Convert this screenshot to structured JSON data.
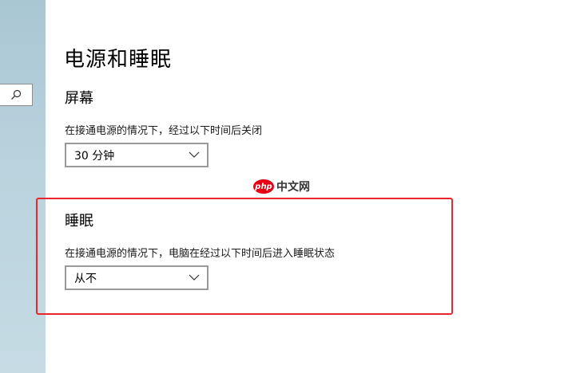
{
  "page": {
    "title": "电源和睡眠"
  },
  "search": {
    "icon": "search-icon"
  },
  "screen_section": {
    "title": "屏幕",
    "description": "在接通电源的情况下，经过以下时间后关闭",
    "selected": "30 分钟"
  },
  "sleep_section": {
    "title": "睡眠",
    "description": "在接通电源的情况下，电脑在经过以下时间后进入睡眠状态",
    "selected": "从不"
  },
  "watermark": {
    "badge": "php",
    "text": "中文网"
  },
  "colors": {
    "highlight": "#e8262b",
    "sidebar": "#b9d3de",
    "watermark_red": "#e60012"
  }
}
